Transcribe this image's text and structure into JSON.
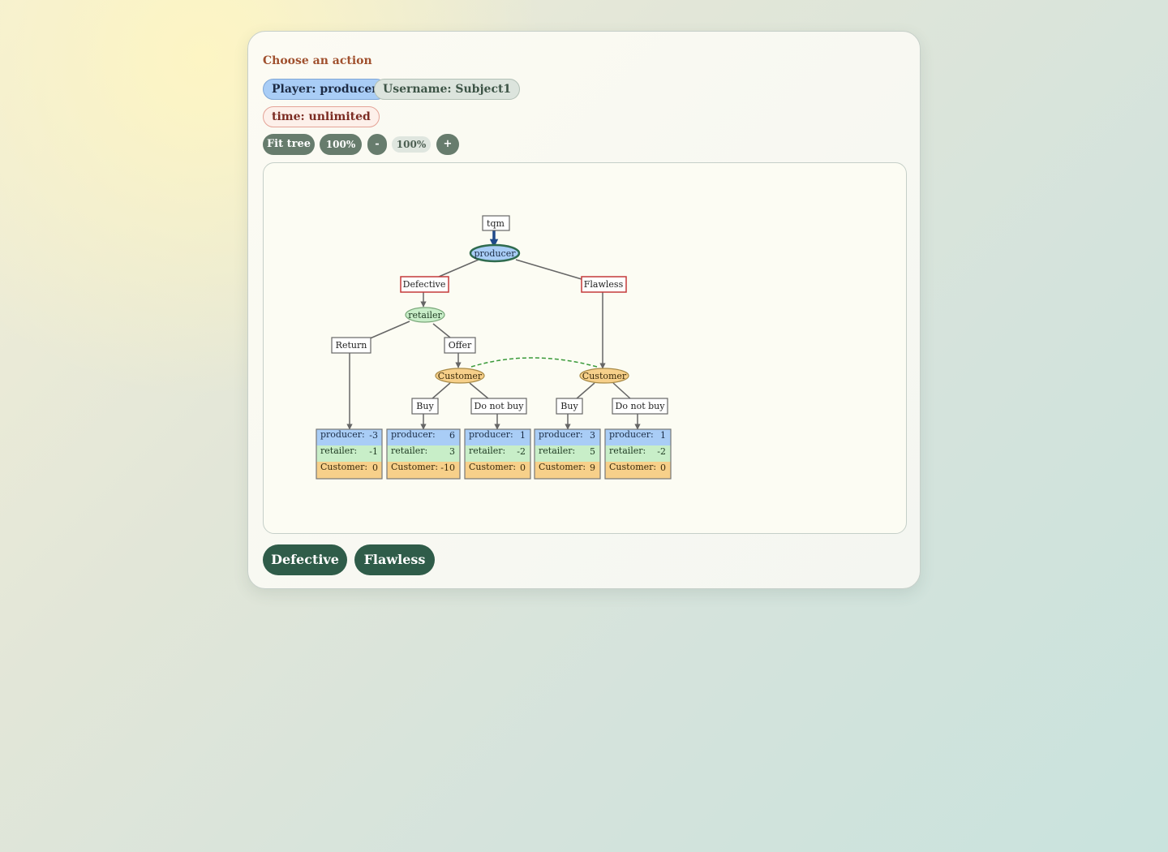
{
  "header": {
    "title": "Choose an action",
    "player_label": "Player: producer",
    "username_label": "Username: Subject1",
    "time_label": "time: unlimited"
  },
  "controls": {
    "fit_label": "Fit tree",
    "reset_zoom_label": "100%",
    "zoom_out_label": "-",
    "zoom_level": "100%",
    "zoom_in_label": "+"
  },
  "colors": {
    "producer": "#a9cdf6",
    "retailer": "#c8eec8",
    "customer": "#f7d08a",
    "action_button": "#2f5c49",
    "heading": "#a0502e"
  },
  "tree": {
    "root_label": "tqm",
    "nodes": {
      "producer": "producer",
      "retailer": "retailer",
      "customer1": "Customer",
      "customer2": "Customer"
    },
    "actions": {
      "defective": "Defective",
      "flawless": "Flawless",
      "return": "Return",
      "offer": "Offer",
      "buy1": "Buy",
      "notbuy1": "Do not buy",
      "buy2": "Buy",
      "notbuy2": "Do not buy"
    },
    "payoff_labels": {
      "producer": "producer:",
      "retailer": "retailer:",
      "customer": "Customer:"
    },
    "payoffs": [
      {
        "producer": "-3",
        "retailer": "-1",
        "customer": "0"
      },
      {
        "producer": "6",
        "retailer": "3",
        "customer": "-10"
      },
      {
        "producer": "1",
        "retailer": "-2",
        "customer": "0"
      },
      {
        "producer": "3",
        "retailer": "5",
        "customer": "9"
      },
      {
        "producer": "1",
        "retailer": "-2",
        "customer": "0"
      }
    ]
  },
  "action_buttons": {
    "defective": "Defective",
    "flawless": "Flawless"
  }
}
